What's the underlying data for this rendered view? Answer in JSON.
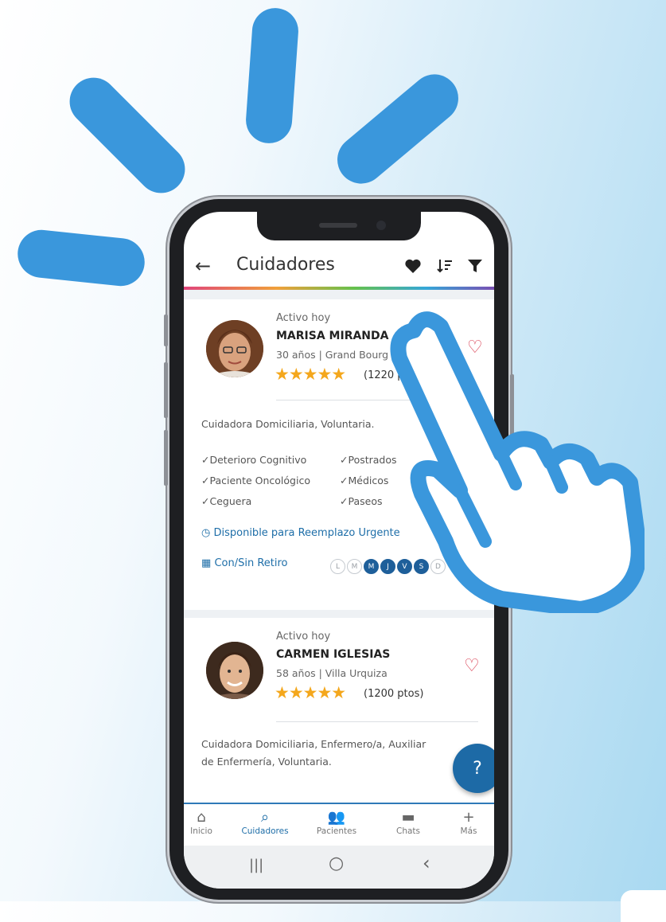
{
  "app": {
    "title": "Cuidadores"
  },
  "icons": {
    "back": "arrow-left-icon",
    "favorites": "heart-icon",
    "sort": "sort-icon",
    "filter": "filter-icon"
  },
  "caregivers": [
    {
      "status": "Activo hoy",
      "name": "MARISA MIRANDA",
      "details": "30 años | Grand Bourg",
      "stars": "★★★★★",
      "points": "(1220 ptos)",
      "description": "Cuidadora Domiciliaria, Voluntaria.",
      "skills": [
        "Deterioro Cognitivo",
        "Postrados",
        "Paciente Oncológico",
        "Médicos",
        "Ceguera",
        "Paseos"
      ],
      "urgent": "Disponible para Reemplazo Urgente",
      "schedule": "Con/Sin Retiro",
      "days": [
        {
          "d": "L",
          "on": false
        },
        {
          "d": "M",
          "on": false
        },
        {
          "d": "M",
          "on": true
        },
        {
          "d": "J",
          "on": true
        },
        {
          "d": "V",
          "on": true
        },
        {
          "d": "S",
          "on": true
        },
        {
          "d": "D",
          "on": false
        }
      ]
    },
    {
      "status": "Activo hoy",
      "name": "CARMEN IGLESIAS",
      "details": "58 años | Villa Urquiza",
      "stars": "★★★★★",
      "points": "(1200 ptos)",
      "description": "Cuidadora Domiciliaria, Enfermero/a, Auxiliar de Enfermería, Voluntaria."
    }
  ],
  "fab": {
    "label": "?"
  },
  "nav": [
    {
      "label": "Inicio",
      "icon": "home-icon"
    },
    {
      "label": "Cuidadores",
      "icon": "search-icon"
    },
    {
      "label": "Pacientes",
      "icon": "people-icon"
    },
    {
      "label": "Chats",
      "icon": "chat-icon"
    },
    {
      "label": "Más",
      "icon": "plus-icon"
    }
  ],
  "system_nav": {
    "recents": "|||",
    "home": "○",
    "back": "‹"
  },
  "colors": {
    "accent": "#1e6ea8",
    "ray": "#3a97dc",
    "star": "#f4a71c",
    "heart": "#d83a4e"
  }
}
